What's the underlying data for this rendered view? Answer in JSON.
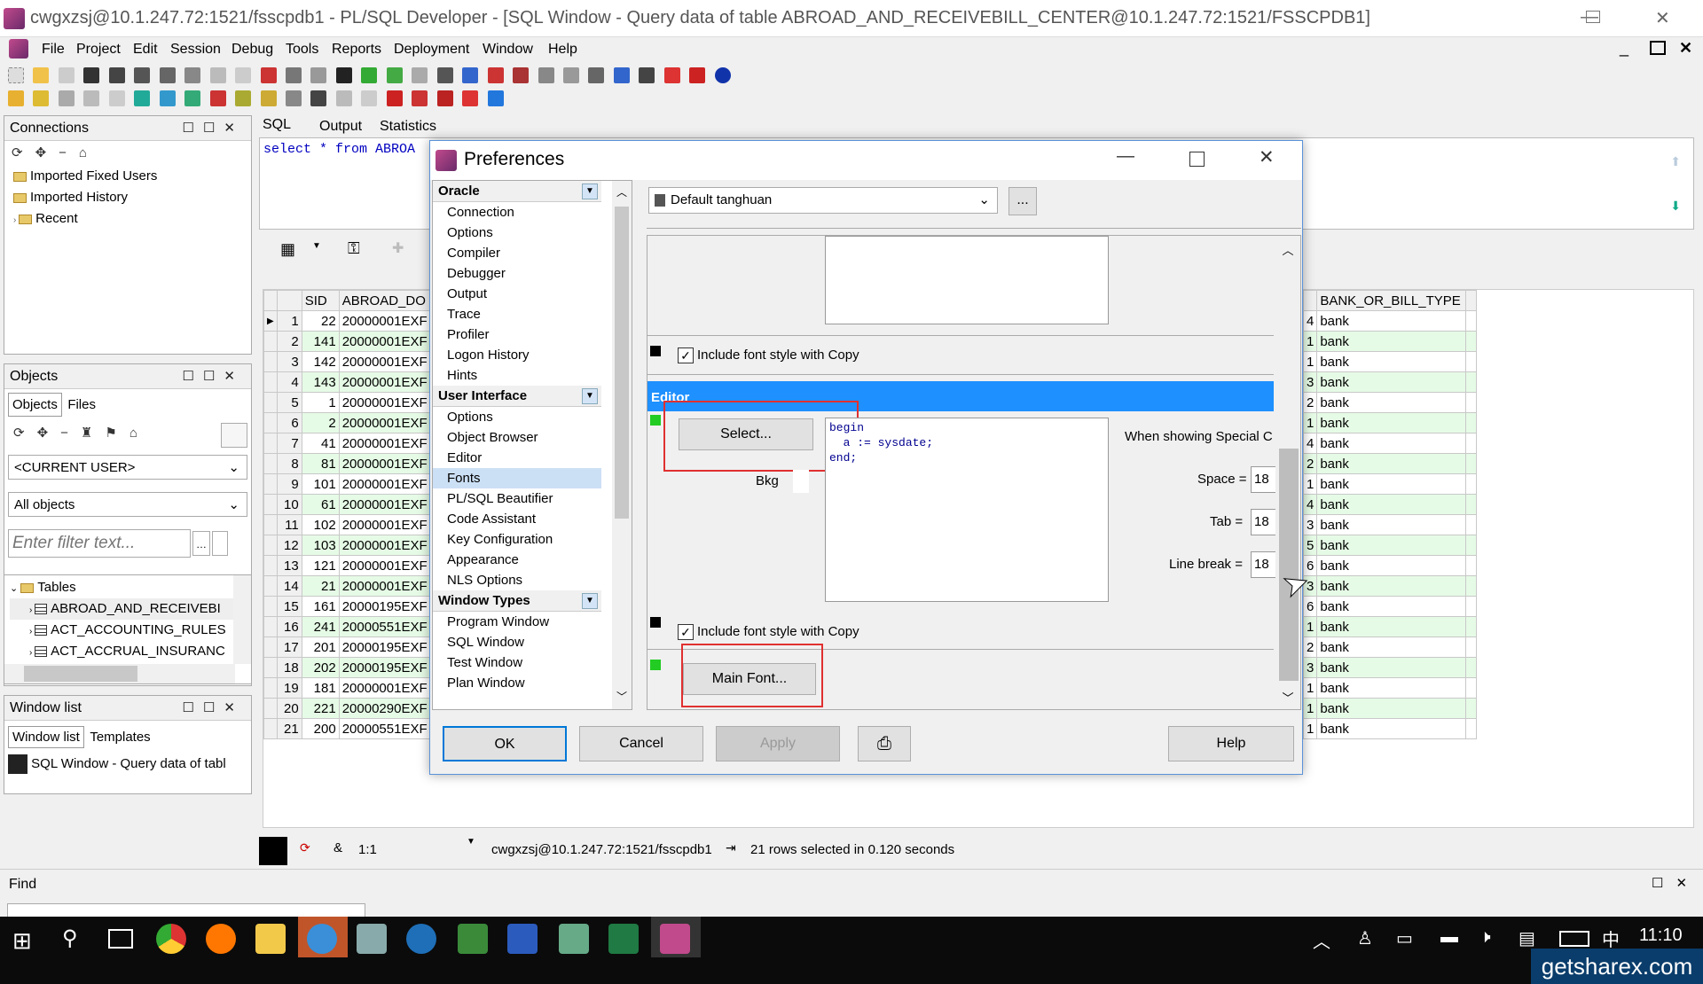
{
  "window": {
    "title": "cwgxzsj@10.1.247.72:1521/fsscpdb1 - PL/SQL Developer - [SQL Window - Query data of table ABROAD_AND_RECEIVEBILL_CENTER@10.1.247.72:1521/FSSCPDB1]"
  },
  "menu": [
    "File",
    "Project",
    "Edit",
    "Session",
    "Debug",
    "Tools",
    "Reports",
    "Deployment",
    "Window",
    "Help"
  ],
  "connections": {
    "title": "Connections",
    "items": [
      "Imported Fixed Users",
      "Imported History",
      "Recent"
    ]
  },
  "objects": {
    "title": "Objects",
    "tabs": [
      "Objects",
      "Files"
    ],
    "user": "<CURRENT USER>",
    "filter": "All objects",
    "filter_placeholder": "Enter filter text...",
    "tree_root": "Tables",
    "tables": [
      "ABROAD_AND_RECEIVEBI",
      "ACT_ACCOUNTING_RULES",
      "ACT_ACCRUAL_INSURANC"
    ]
  },
  "windowlist": {
    "title": "Window list",
    "tabs": [
      "Window list",
      "Templates"
    ],
    "item": "SQL Window - Query data of tabl"
  },
  "sql": {
    "tabs": [
      "SQL",
      "Output",
      "Statistics"
    ],
    "text": "select * from ABROA"
  },
  "grid": {
    "headers": [
      "SID",
      "ABROAD_DO",
      "BANK_OR_BILL_TYPE"
    ],
    "rows": [
      {
        "n": "1",
        "sid": "22",
        "doc": "20000001EXF",
        "k": "4",
        "t": "bank"
      },
      {
        "n": "2",
        "sid": "141",
        "doc": "20000001EXF",
        "k": "1",
        "t": "bank"
      },
      {
        "n": "3",
        "sid": "142",
        "doc": "20000001EXF",
        "k": "1",
        "t": "bank"
      },
      {
        "n": "4",
        "sid": "143",
        "doc": "20000001EXF",
        "k": "3",
        "t": "bank"
      },
      {
        "n": "5",
        "sid": "1",
        "doc": "20000001EXF",
        "k": "2",
        "t": "bank"
      },
      {
        "n": "6",
        "sid": "2",
        "doc": "20000001EXF",
        "k": "1",
        "t": "bank"
      },
      {
        "n": "7",
        "sid": "41",
        "doc": "20000001EXF",
        "k": "4",
        "t": "bank"
      },
      {
        "n": "8",
        "sid": "81",
        "doc": "20000001EXF",
        "k": "2",
        "t": "bank"
      },
      {
        "n": "9",
        "sid": "101",
        "doc": "20000001EXF",
        "k": "1",
        "t": "bank"
      },
      {
        "n": "10",
        "sid": "61",
        "doc": "20000001EXF",
        "k": "4",
        "t": "bank"
      },
      {
        "n": "11",
        "sid": "102",
        "doc": "20000001EXF",
        "k": "3",
        "t": "bank"
      },
      {
        "n": "12",
        "sid": "103",
        "doc": "20000001EXF",
        "k": "5",
        "t": "bank"
      },
      {
        "n": "13",
        "sid": "121",
        "doc": "20000001EXF",
        "k": "6",
        "t": "bank"
      },
      {
        "n": "14",
        "sid": "21",
        "doc": "20000001EXF",
        "k": "3",
        "t": "bank"
      },
      {
        "n": "15",
        "sid": "161",
        "doc": "20000195EXF",
        "k": "6",
        "t": "bank"
      },
      {
        "n": "16",
        "sid": "241",
        "doc": "20000551EXF",
        "k": "1",
        "t": "bank"
      },
      {
        "n": "17",
        "sid": "201",
        "doc": "20000195EXF",
        "k": "2",
        "t": "bank"
      },
      {
        "n": "18",
        "sid": "202",
        "doc": "20000195EXF",
        "k": "3",
        "t": "bank"
      },
      {
        "n": "19",
        "sid": "181",
        "doc": "20000001EXF",
        "k": "1",
        "t": "bank"
      },
      {
        "n": "20",
        "sid": "221",
        "doc": "20000290EXF",
        "k": "1",
        "t": "bank"
      },
      {
        "n": "21",
        "sid": "200",
        "doc": "20000551EXF",
        "k": "1",
        "t": "bank"
      }
    ]
  },
  "status": {
    "pos": "1:1",
    "conn": "cwgxzsj@10.1.247.72:1521/fsscpdb1",
    "msg": "21 rows selected in 0.120 seconds"
  },
  "find": {
    "label": "Find"
  },
  "prefs": {
    "title": "Preferences",
    "profile": "Default tanghuan",
    "sections": [
      {
        "name": "Oracle",
        "items": [
          "Connection",
          "Options",
          "Compiler",
          "Debugger",
          "Output",
          "Trace",
          "Profiler",
          "Logon History",
          "Hints"
        ]
      },
      {
        "name": "User Interface",
        "items": [
          "Options",
          "Object Browser",
          "Editor",
          "Fonts",
          "PL/SQL Beautifier",
          "Code Assistant",
          "Key Configuration",
          "Appearance",
          "NLS Options"
        ]
      },
      {
        "name": "Window Types",
        "items": [
          "Program Window",
          "SQL Window",
          "Test Window",
          "Plan Window"
        ]
      }
    ],
    "selected": "Fonts",
    "include_copy": "Include font style with Copy",
    "editor_header": "Editor",
    "select_btn": "Select...",
    "bkg": "Bkg",
    "code": [
      "begin",
      "  a := sysdate;",
      "end;"
    ],
    "special": "When showing Special C",
    "space_label": "Space =",
    "tab_label": "Tab =",
    "linebreak_label": "Line break =",
    "val": "18",
    "main_font_btn": "Main Font...",
    "ok": "OK",
    "cancel": "Cancel",
    "apply": "Apply",
    "help": "Help",
    "more": "..."
  },
  "tray": {
    "time": "11:10",
    "ime": "中"
  },
  "watermark": "getsharex.com"
}
